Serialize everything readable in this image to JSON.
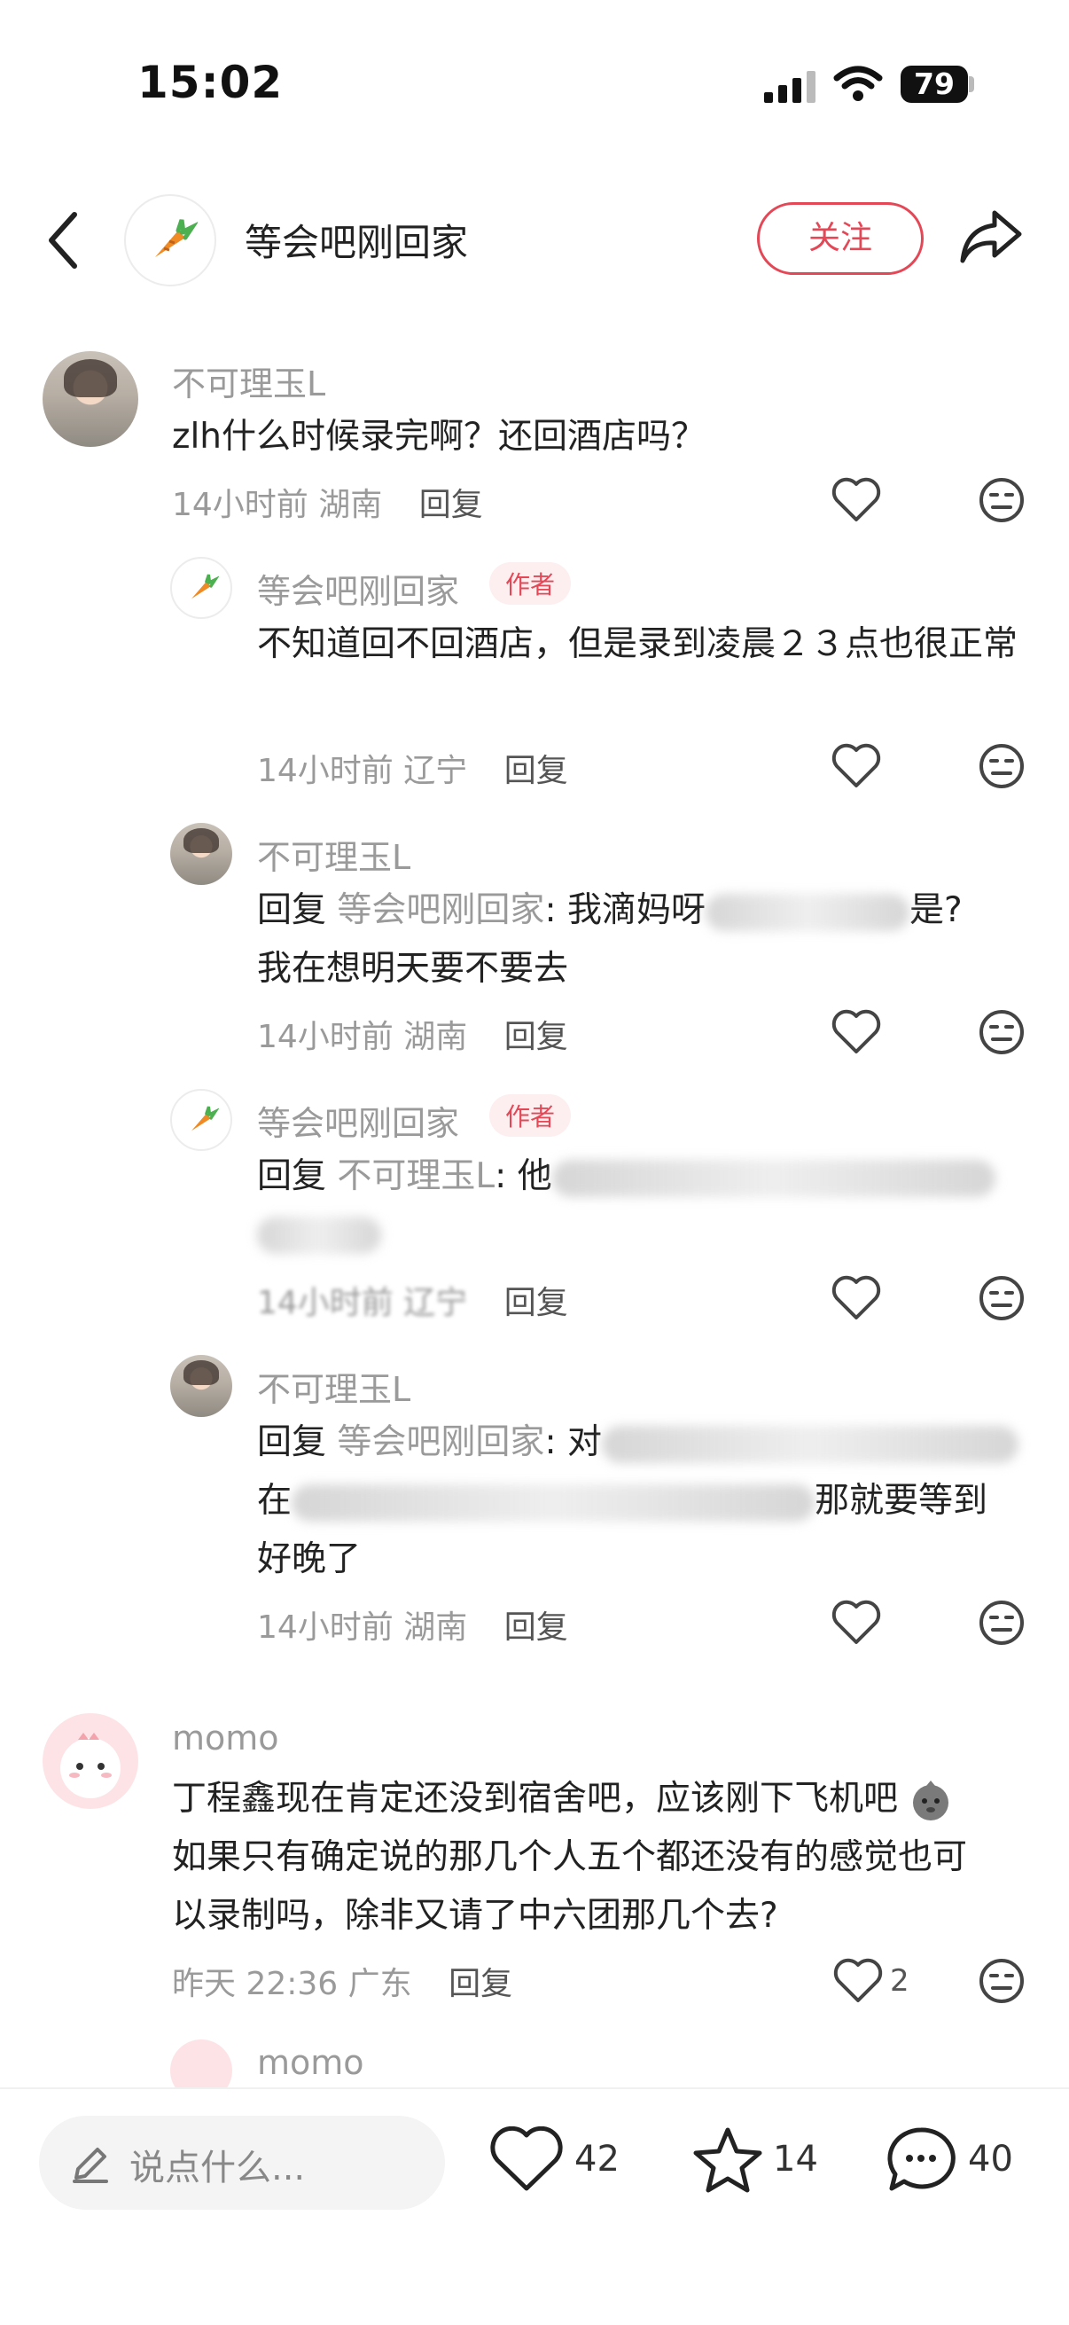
{
  "status_bar": {
    "time": "15:02",
    "battery": "79"
  },
  "header": {
    "title": "等会吧刚回家",
    "follow_label": "关注"
  },
  "comments": [
    {
      "author": "不可理玉L",
      "text": "zlh什么时候录完啊？还回酒店吗？",
      "time": "14小时前",
      "location": "湖南",
      "reply_label": "回复"
    },
    {
      "author": "等会吧刚回家",
      "badge": "作者",
      "text": "不知道回不回酒店，但是录到凌晨２３点也很正常",
      "time": "14小时前",
      "location": "辽宁",
      "reply_label": "回复"
    },
    {
      "author": "不可理玉L",
      "reply_prefix": "回复",
      "reply_to": "等会吧刚回家",
      "text_visible_start": ": 我滴妈呀",
      "text_visible_end": "是?",
      "text_line2": "我在想明天要不要去",
      "time": "14小时前",
      "location": "湖南",
      "reply_label": "回复"
    },
    {
      "author": "等会吧刚回家",
      "badge": "作者",
      "reply_prefix": "回复",
      "reply_to": "不可理玉L",
      "text_visible_start": ": 他",
      "time": "14小时前",
      "location": "辽宁",
      "reply_label": "回复"
    },
    {
      "author": "不可理玉L",
      "reply_prefix": "回复",
      "reply_to": "等会吧刚回家",
      "text_visible_start": ": 对",
      "line2_start": "在",
      "line2_end": "那就要等到",
      "line3": "好晚了",
      "time": "14小时前",
      "location": "湖南",
      "reply_label": "回复"
    },
    {
      "author": "momo",
      "text_line1": "丁程鑫现在肯定还没到宿舍吧，应该刚下飞机吧",
      "text_line2": "如果只有确定说的那几个人五个都还没有的感觉也可",
      "text_line3": "以录制吗，除非又请了中六团那几个去?",
      "time": "昨天 22:36",
      "location": "广东",
      "reply_label": "回复",
      "likes": "2"
    },
    {
      "author": "momo"
    }
  ],
  "bottom_bar": {
    "input_placeholder": "说点什么...",
    "likes": "42",
    "stars": "14",
    "comments": "40"
  },
  "icons": [
    "back-icon",
    "carrot-icon",
    "share-icon",
    "heart-icon",
    "dislike-icon",
    "pencil-icon",
    "star-icon",
    "comment-icon",
    "wifi-icon",
    "signal-icon",
    "battery-icon"
  ],
  "colors": {
    "accent": "#e44756",
    "muted_text": "#9a9a9a",
    "text": "#222222"
  }
}
